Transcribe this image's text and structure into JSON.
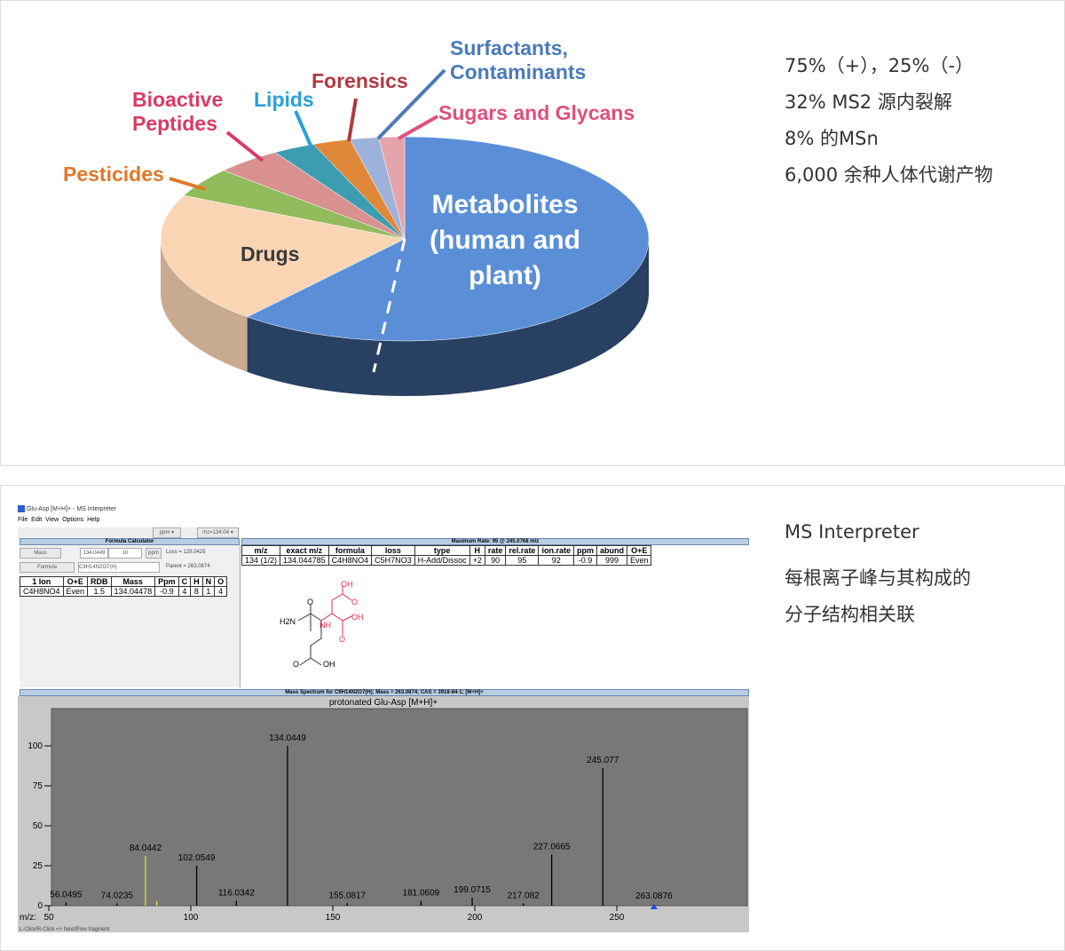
{
  "chart_data": [
    {
      "type": "pie",
      "style": "3d",
      "categories": [
        "Metabolites (human and plant)",
        "Drugs",
        "Pesticides",
        "Bioactive Peptides",
        "Lipids",
        "Forensics",
        "Surfactants, Contaminants",
        "Sugars and Glycans"
      ],
      "values": [
        61.1,
        20.8,
        4.7,
        4.4,
        2.8,
        2.5,
        1.9,
        1.7
      ],
      "colors": [
        "#5a8fd8",
        "#f9d5b4",
        "#92bb5c",
        "#d99090",
        "#3c9db0",
        "#e0883a",
        "#9cb2da",
        "#e4a4ac"
      ],
      "label_colors": [
        "#ffffff",
        "#3a3a3a",
        "#e0782a",
        "#d83a64",
        "#2aa0d8",
        "#b03a40",
        "#4a7ab8",
        "#e0507a"
      ]
    },
    {
      "type": "bar",
      "title": "protonated Glu-Asp [M+H]+",
      "xlabel": "m/z:",
      "xlim": [
        45,
        290
      ],
      "ylim": [
        0,
        110
      ],
      "xticks": [
        50,
        100,
        150,
        200,
        250
      ],
      "yticks": [
        0,
        25,
        50,
        75,
        100
      ],
      "peaks": [
        {
          "mz": 56.0495,
          "i": 2
        },
        {
          "mz": 74.0235,
          "i": 1.5
        },
        {
          "mz": 84.0442,
          "i": 31,
          "color": "#e0e040"
        },
        {
          "mz": 88,
          "i": 3,
          "color": "#e0e040"
        },
        {
          "mz": 102.0549,
          "i": 25
        },
        {
          "mz": 116.0342,
          "i": 3
        },
        {
          "mz": 134.0449,
          "i": 100
        },
        {
          "mz": 155.0817,
          "i": 1.5
        },
        {
          "mz": 181.0609,
          "i": 3
        },
        {
          "mz": 199.0715,
          "i": 5
        },
        {
          "mz": 217.082,
          "i": 1.5
        },
        {
          "mz": 227.0665,
          "i": 32
        },
        {
          "mz": 245.077,
          "i": 86
        },
        {
          "mz": 263.0876,
          "i": 1
        }
      ]
    }
  ],
  "pie_labels": [
    "Metabolites\n(human and\nplant)",
    "Drugs",
    "Pesticides",
    "Bioactive\nPeptides",
    "Lipids",
    "Forensics",
    "Surfactants,\nContaminants",
    "Sugars and Glycans"
  ],
  "side1": [
    "75%（+），25%（-）",
    "32% MS2 源内裂解",
    "8% 的MSn",
    "6,000 余种人体代谢产物"
  ],
  "side2": {
    "title": "MS Interpreter",
    "desc1": "每根离子峰与其构成的",
    "desc2": "分子结构相关联"
  },
  "app": {
    "title": "Glu-Asp [M+H]+ - MS Interpreter",
    "menu": [
      "File",
      "Edit",
      "View",
      "Options",
      "Help"
    ],
    "ppm": "ppm ▾",
    "mz": "mz=134.04 ▾",
    "fc_title": "Formula Calculator",
    "mass_btn": "Mass",
    "mass_val": "134.0449",
    "tol": "10",
    "ppm_btn": "ppm",
    "loss": "Loss = 129.0425",
    "formula_btn": "Formula",
    "formula_val": "C9H14N2O7(H)",
    "parent": "Parent = 263.0874",
    "calc_head": [
      "1 Ion",
      "O+E",
      "RDB",
      "Mass",
      "Ppm",
      "C",
      "H",
      "N",
      "O"
    ],
    "calc_row": [
      "C4H8NO4",
      "Even",
      "1.5",
      "134.04478",
      "-0.9",
      "4",
      "8",
      "1",
      "4"
    ],
    "max_rate": "Maximum Rate: 95 @ 245.0768 m/z",
    "frag_head": [
      "m/z",
      "exact m/z",
      "formula",
      "loss",
      "type",
      "H",
      "rate",
      "rel.rate",
      "ion.rate",
      "ppm",
      "abund",
      "O+E"
    ],
    "frag_row": [
      "134 (1/2)",
      "134.044785",
      "C4H8NO4",
      "C5H7NO3",
      "H-Add/Dissoc",
      "+2",
      "90",
      "95",
      "92",
      "-0.9",
      "999",
      "Even"
    ],
    "spec_bar": "Mass Spectrum for C9H14N2O7(H); Mass = 263.0874; CAS = 3918-84-1; [M+H]+",
    "status": "L-Click/R-Click => Next/Prev fragment",
    "struct": {
      "oh1": "OH",
      "o1": "O",
      "h2n": "H2N",
      "o2": "O",
      "nh": "NH",
      "oh2": "OH",
      "o3": "O",
      "o4": "O",
      "oh3": "OH"
    }
  }
}
